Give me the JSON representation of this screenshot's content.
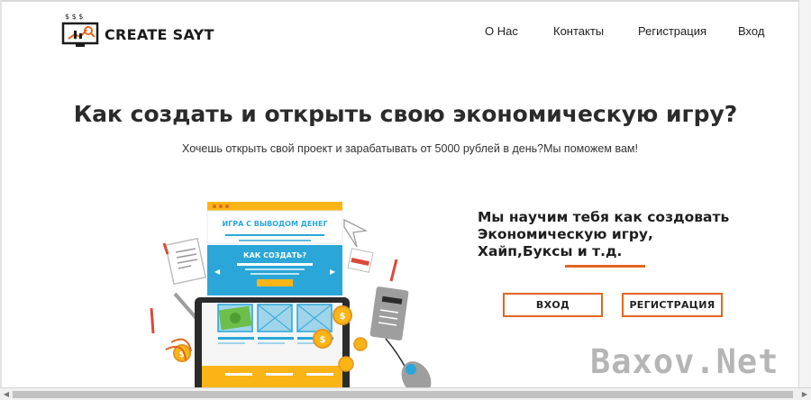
{
  "brand": {
    "name": "CREATE SAYT",
    "logo_symbols": "$ $ $"
  },
  "nav": {
    "items": [
      {
        "label": "О Нас"
      },
      {
        "label": "Контакты"
      },
      {
        "label": "Регистрация"
      },
      {
        "label": "Вход"
      }
    ]
  },
  "hero": {
    "title": "Как создать и открыть свою экономическую игру?",
    "subtitle": "Хочешь открыть свой проект и зарабатывать от 5000 рублей в день?Мы поможем вам!"
  },
  "illustration": {
    "banner_text": "ИГРА С ВЫВОДОМ ДЕНЕГ",
    "slide_text": "КАК СОЗДАТЬ?",
    "coin_symbol": "$"
  },
  "pitch": {
    "lines": [
      "Мы научим тебя как создовать",
      "Экономическую игру,",
      "Хайп,Буксы и т.д."
    ]
  },
  "buttons": {
    "login": "ВХОД",
    "register": "РЕГИСТРАЦИЯ"
  },
  "watermark": {
    "text": "Baxov.Net"
  },
  "colors": {
    "accent": "#e2661f",
    "banner_blue": "#2aa6d8",
    "panel_yellow": "#fbb416",
    "dark": "#2b2b2b"
  }
}
